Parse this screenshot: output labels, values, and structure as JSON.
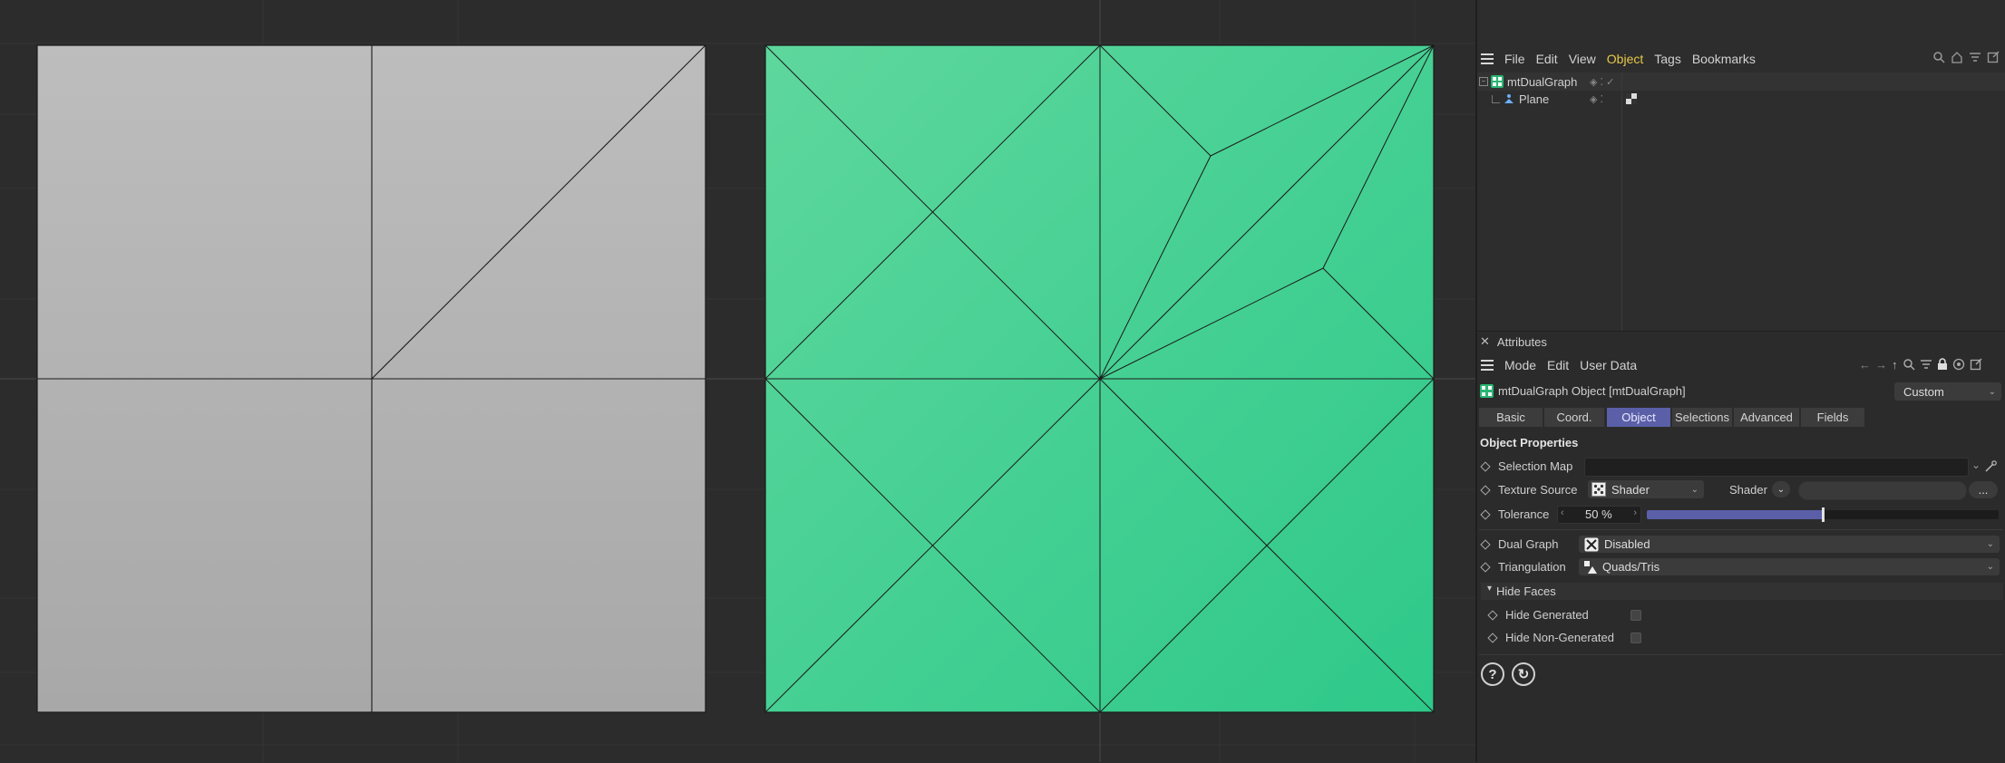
{
  "object_manager": {
    "menu": [
      "File",
      "Edit",
      "View",
      "Object",
      "Tags",
      "Bookmarks"
    ],
    "active_menu_index": 3,
    "tree": [
      {
        "label": "mtDualGraph"
      },
      {
        "label": "Plane"
      }
    ]
  },
  "attributes": {
    "title": "Attributes",
    "menu": [
      "Mode",
      "Edit",
      "User Data"
    ],
    "object_title": "mtDualGraph Object [mtDualGraph]",
    "preset": "Custom",
    "tabs": [
      "Basic",
      "Coord.",
      "Object",
      "Selections",
      "Advanced",
      "Fields"
    ],
    "active_tab_index": 2,
    "section": "Object Properties",
    "selection_map_label": "Selection Map",
    "texture_source_label": "Texture Source",
    "texture_source_value": "Shader",
    "shader_label": "Shader",
    "shader_more": "...",
    "tolerance_label": "Tolerance",
    "tolerance_value": "50 %",
    "tolerance_fraction": 0.5,
    "dual_graph_label": "Dual Graph",
    "dual_graph_value": "Disabled",
    "triangulation_label": "Triangulation",
    "triangulation_value": "Quads/Tris",
    "hide_faces_label": "Hide Faces",
    "hide_generated_label": "Hide Generated",
    "hide_non_generated_label": "Hide Non-Generated"
  },
  "colors": {
    "viewport_bg": "#2c2c2c",
    "grey_plane": "#b4b4b4",
    "green_plane": "#44cf91",
    "accent_tab": "#5a5fa8",
    "active_menu": "#e8c84a",
    "slider_fill": "#5a5fa8"
  },
  "icons": [
    "menu-icon",
    "search-icon",
    "home-icon",
    "filter-icon",
    "new-window-icon",
    "close-icon",
    "back-arrow-icon",
    "forward-arrow-icon",
    "up-arrow-icon",
    "lock-icon",
    "target-icon",
    "help-icon",
    "reset-icon",
    "checkerboard-icon",
    "cross-icon"
  ]
}
